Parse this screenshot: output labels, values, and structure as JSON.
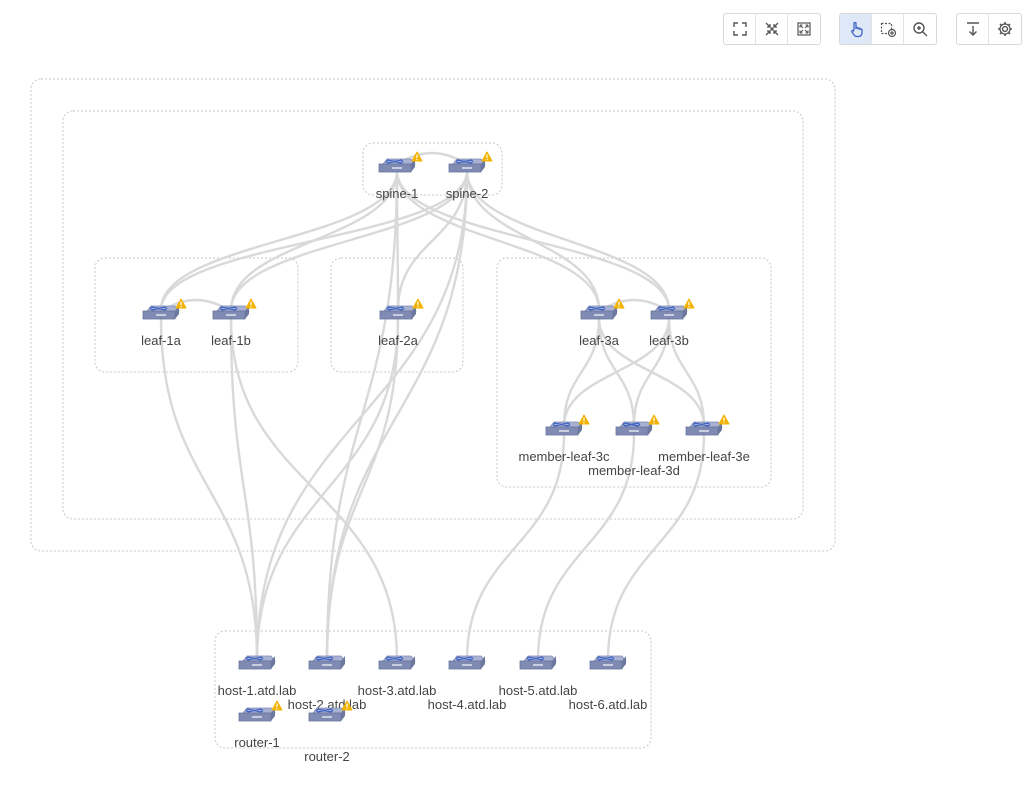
{
  "toolbar": {
    "groups": [
      [
        {
          "name": "fit-view-button",
          "icon": "fit-view-icon"
        },
        {
          "name": "collapse-all-button",
          "icon": "collapse-icon"
        },
        {
          "name": "expand-all-button",
          "icon": "expand-icon"
        }
      ],
      [
        {
          "name": "pan-mode-button",
          "icon": "hand-pointer-icon",
          "active": true
        },
        {
          "name": "select-mode-button",
          "icon": "select-add-icon"
        },
        {
          "name": "zoom-mode-button",
          "icon": "zoom-in-icon"
        }
      ],
      [
        {
          "name": "export-button",
          "icon": "download-icon"
        },
        {
          "name": "settings-button",
          "icon": "gear-icon"
        }
      ]
    ]
  },
  "colors": {
    "accent": "#3d63c4",
    "device": "#7f8bb3",
    "link": "#d9d9d9",
    "group_border": "#c7c7c7",
    "warning": "#f2b300"
  },
  "devices": [
    {
      "id": "spine-1",
      "label": "spine-1",
      "warning": true
    },
    {
      "id": "spine-2",
      "label": "spine-2",
      "warning": true
    },
    {
      "id": "leaf-1a",
      "label": "leaf-1a",
      "warning": true
    },
    {
      "id": "leaf-1b",
      "label": "leaf-1b",
      "warning": true
    },
    {
      "id": "leaf-2a",
      "label": "leaf-2a",
      "warning": true
    },
    {
      "id": "leaf-3a",
      "label": "leaf-3a",
      "warning": true
    },
    {
      "id": "leaf-3b",
      "label": "leaf-3b",
      "warning": true
    },
    {
      "id": "member-leaf-3c",
      "label": "member-leaf-3c",
      "warning": true
    },
    {
      "id": "member-leaf-3d",
      "label": "member-leaf-3d",
      "warning": true
    },
    {
      "id": "member-leaf-3e",
      "label": "member-leaf-3e",
      "warning": true
    },
    {
      "id": "host-1",
      "label": "host-1.atd.lab",
      "warning": false
    },
    {
      "id": "host-2",
      "label": "host-2.atd.lab",
      "warning": false
    },
    {
      "id": "host-3",
      "label": "host-3.atd.lab",
      "warning": false
    },
    {
      "id": "host-4",
      "label": "host-4.atd.lab",
      "warning": false
    },
    {
      "id": "host-5",
      "label": "host-5.atd.lab",
      "warning": false
    },
    {
      "id": "host-6",
      "label": "host-6.atd.lab",
      "warning": false
    },
    {
      "id": "router-1",
      "label": "router-1",
      "warning": true
    },
    {
      "id": "router-2",
      "label": "router-2",
      "warning": true
    }
  ],
  "links": [
    [
      "spine-1",
      "spine-2"
    ],
    [
      "leaf-1a",
      "leaf-1b"
    ],
    [
      "leaf-3a",
      "leaf-3b"
    ],
    [
      "spine-1",
      "leaf-1a"
    ],
    [
      "spine-1",
      "leaf-1b"
    ],
    [
      "spine-1",
      "leaf-2a"
    ],
    [
      "spine-1",
      "leaf-3a"
    ],
    [
      "spine-1",
      "leaf-3b"
    ],
    [
      "spine-2",
      "leaf-1a"
    ],
    [
      "spine-2",
      "leaf-1b"
    ],
    [
      "spine-2",
      "leaf-2a"
    ],
    [
      "spine-2",
      "leaf-3a"
    ],
    [
      "spine-2",
      "leaf-3b"
    ],
    [
      "leaf-3a",
      "member-leaf-3c"
    ],
    [
      "leaf-3a",
      "member-leaf-3d"
    ],
    [
      "leaf-3a",
      "member-leaf-3e"
    ],
    [
      "leaf-3b",
      "member-leaf-3c"
    ],
    [
      "leaf-3b",
      "member-leaf-3d"
    ],
    [
      "leaf-3b",
      "member-leaf-3e"
    ],
    [
      "leaf-1a",
      "host-1"
    ],
    [
      "leaf-1b",
      "host-1"
    ],
    [
      "leaf-1b",
      "host-3"
    ],
    [
      "leaf-2a",
      "host-1"
    ],
    [
      "leaf-2a",
      "host-2"
    ],
    [
      "spine-1",
      "host-2"
    ],
    [
      "spine-2",
      "host-1"
    ],
    [
      "spine-2",
      "host-2"
    ],
    [
      "member-leaf-3c",
      "host-4"
    ],
    [
      "member-leaf-3d",
      "host-5"
    ],
    [
      "member-leaf-3e",
      "host-6"
    ]
  ]
}
